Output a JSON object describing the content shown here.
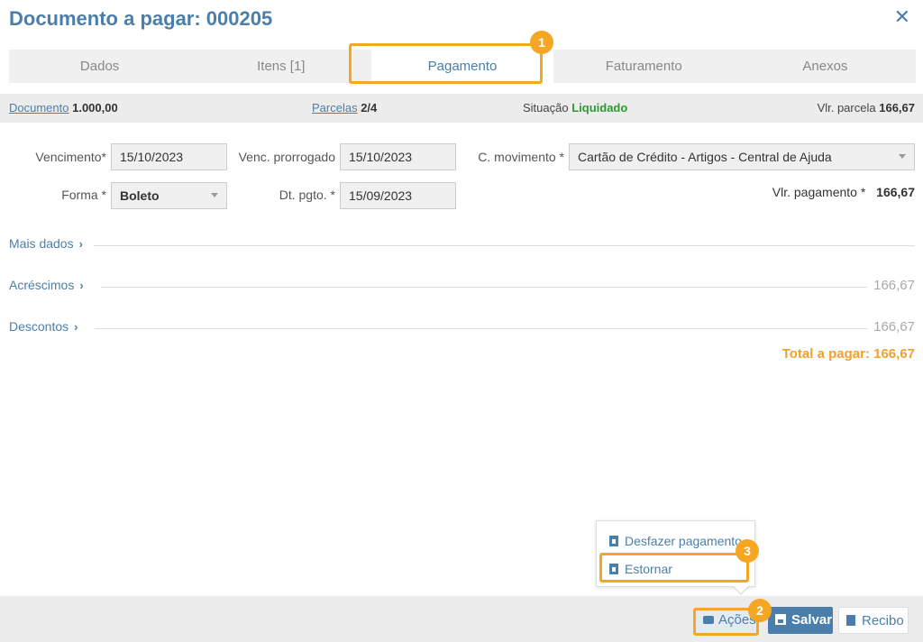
{
  "title": "Documento a pagar: 000205",
  "tabs": [
    {
      "label": "Dados"
    },
    {
      "label": "Itens [1]"
    },
    {
      "label": "Pagamento"
    },
    {
      "label": "Faturamento"
    },
    {
      "label": "Anexos"
    }
  ],
  "active_tab": "Pagamento",
  "info": {
    "documento_label": "Documento",
    "documento_value": "1.000,00",
    "parcelas_label": "Parcelas",
    "parcelas_value": "2/4",
    "situacao_label": "Situação",
    "situacao_value": "Liquidado",
    "vlr_parcela_label": "Vlr. parcela",
    "vlr_parcela_value": "166,67"
  },
  "form": {
    "vencimento_label": "Vencimento*",
    "vencimento_value": "15/10/2023",
    "venc_prorrogado_label": "Venc. prorrogado",
    "venc_prorrogado_value": "15/10/2023",
    "c_movimento_label": "C. movimento *",
    "c_movimento_value": "Cartão de Crédito - Artigos - Central de Ajuda",
    "forma_label": "Forma *",
    "forma_value": "Boleto",
    "dt_pgto_label": "Dt. pgto. *",
    "dt_pgto_value": "15/09/2023",
    "vlr_pagamento_label": "Vlr. pagamento *",
    "vlr_pagamento_value": "166,67"
  },
  "sections": {
    "mais_dados": "Mais dados",
    "acrescimos": "Acréscimos",
    "acrescimos_value": "166,67",
    "descontos": "Descontos",
    "descontos_value": "166,67",
    "total": "Total a pagar: 166,67"
  },
  "menu": {
    "desfazer": "Desfazer pagamento",
    "estornar": "Estornar"
  },
  "buttons": {
    "acoes": "Ações",
    "salvar": "Salvar",
    "recibo": "Recibo"
  },
  "badges": [
    "1",
    "2",
    "3"
  ],
  "colors": {
    "accent": "#4a7fab",
    "highlight": "#f5a623",
    "success": "#2e9b2e",
    "total": "#f0a030"
  }
}
